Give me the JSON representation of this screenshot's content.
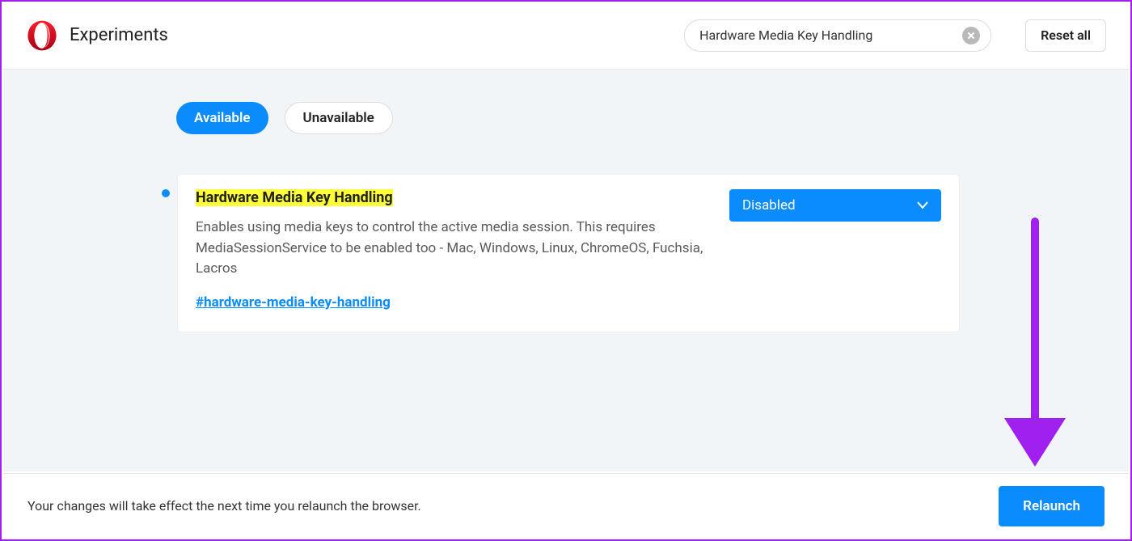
{
  "header": {
    "title": "Experiments",
    "search_value": "Hardware Media Key Handling",
    "reset_label": "Reset all"
  },
  "tabs": {
    "available": "Available",
    "unavailable": "Unavailable"
  },
  "flag": {
    "title": "Hardware Media Key Handling",
    "description": "Enables using media keys to control the active media session. This requires MediaSessionService to be enabled too - Mac, Windows, Linux, ChromeOS, Fuchsia, Lacros",
    "link": "#hardware-media-key-handling",
    "selected_value": "Disabled"
  },
  "footer": {
    "message": "Your changes will take effect the next time you relaunch the browser.",
    "relaunch": "Relaunch"
  }
}
